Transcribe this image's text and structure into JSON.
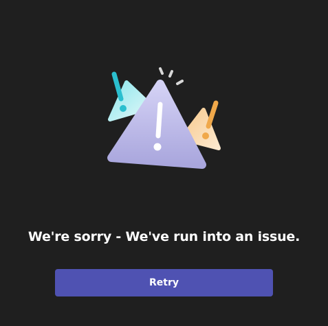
{
  "error": {
    "message": "We're sorry - We've run into an issue.",
    "retry_label": "Retry"
  },
  "illustration": {
    "icon": "warning-triangles-illustration",
    "colors": {
      "main_triangle": "#b8b6e6",
      "teal_triangle": "#bdeff0",
      "teal_accent": "#2bbfcf",
      "orange_triangle": "#fcdcb0",
      "orange_accent": "#f0a84a",
      "background": "#1f1f1f",
      "button": "#4f52b2"
    }
  }
}
